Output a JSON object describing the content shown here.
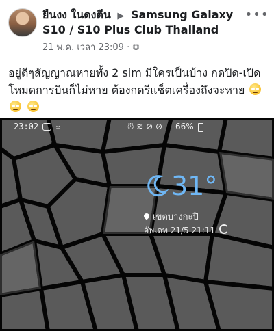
{
  "post": {
    "author": "ยืนงง ในดงตีน",
    "group": "Samsung Galaxy S10 / S10 Plus Club Thailand",
    "timestamp": "21 พ.ค. เวลา 23:09 ·",
    "text": "อยู่ดีๆสัญญาณหายทั้ง 2 sim มีใครเป็นบ้าง กดปิด-เปิดโหมดการบินก็ไม่หาย ต้องกดรีแซ็ตเครื่องถึงจะหาย"
  },
  "screenshot": {
    "time": "23:02",
    "battery": "66%",
    "temperature": "31°",
    "location": "เขตบางกะปิ",
    "updated": "อัพเดท 21/5 21:11"
  },
  "icons": [
    "more-icon",
    "globe-icon",
    "chat-bubble-icon",
    "download-icon",
    "alarm-icon",
    "wifi-icon",
    "no-sim-icon",
    "battery-icon",
    "moon-icon",
    "location-pin-icon",
    "refresh-icon",
    "eye-roll-emoji"
  ]
}
